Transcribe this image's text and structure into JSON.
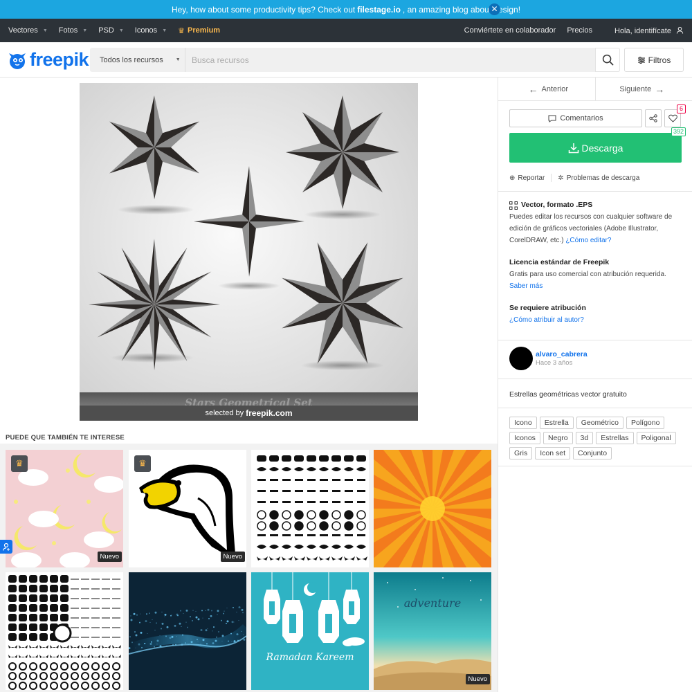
{
  "promo": {
    "text_before": "Hey, how about some productivity tips? Check out",
    "link": "filestage.io",
    "text_after": ", an amazing blog about design!",
    "close": "✕"
  },
  "topnav": {
    "items": [
      "Vectores",
      "Fotos",
      "PSD",
      "Iconos"
    ],
    "premium": "Premium",
    "right": [
      "Conviértete en colaborador",
      "Precios",
      "Hola, identifícate"
    ]
  },
  "header": {
    "logo": "freepik",
    "search_type": "Todos los recursos",
    "search_placeholder": "Busca recursos",
    "filters": "Filtros"
  },
  "image": {
    "strip_text": "Stars Geometrical Set",
    "credit_prefix": "selected by",
    "credit_brand": "freepik.com"
  },
  "panel": {
    "prev": "Anterior",
    "next": "Siguiente",
    "comments": "Comentarios",
    "likes": "6",
    "download": "Descarga",
    "downloads_count": "392",
    "report": "Reportar",
    "download_problems": "Problemas de descarga",
    "format_title": "Vector, formato .EPS",
    "format_text": "Puedes editar los recursos con cualquier software de edición de gráficos vectoriales (Adobe Illustrator, CorelDRAW, etc.)",
    "format_link": "¿Cómo editar?",
    "license_title": "Licencia estándar de Freepik",
    "license_text": "Gratis para uso comercial con atribución requerida.",
    "license_link": "Saber más",
    "attribution_title": "Se requiere atribución",
    "attribution_link": "¿Cómo atribuir al autor?",
    "author_name": "alvaro_cabrera",
    "author_time": "Hace 3 años",
    "description": "Estrellas geométricas vector gratuito",
    "tags": [
      "Icono",
      "Estrella",
      "Geométrico",
      "Polígono",
      "Iconos",
      "Negro",
      "3d",
      "Estrellas",
      "Poligonal",
      "Gris",
      "Icon set",
      "Conjunto"
    ]
  },
  "related": {
    "title": "PUEDE QUE TAMBIÉN TE INTERESE",
    "new_label": "Nuevo",
    "thumb1_ramadan": "Ramadan Kareem",
    "thumb2_adventure": "adventure"
  },
  "colors": {
    "brand_blue": "#1273eb",
    "download_green": "#22c074",
    "premium_gold": "#fcb94d",
    "promo_blue": "#1ca6e0"
  }
}
